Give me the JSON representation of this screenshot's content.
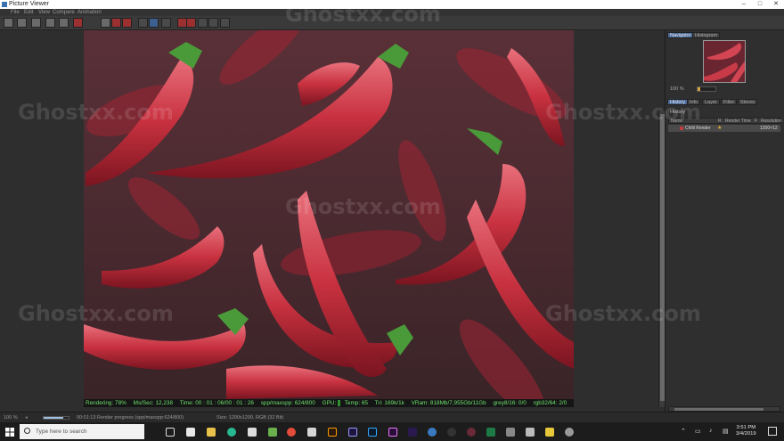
{
  "window": {
    "title": "Picture Viewer",
    "controls": [
      "–",
      "□",
      "✕"
    ]
  },
  "menu": [
    "File",
    "Edit",
    "View",
    "Compare",
    "Animation"
  ],
  "status": {
    "rendering": "Rendering: 78%",
    "mssec": "Ms/Sec: 12,238",
    "time": "Time: 00 : 01 : 06/00 : 01 : 26",
    "spp": "spp/maxspp: 624/800",
    "gpu": "GPU:",
    "temp": "Temp: 65",
    "tri": "Tri: 169k/1k",
    "vram": "VRam: 818Mb/7,955Gb/11Gb",
    "grey": "grey8/16: 0/0",
    "rgb": "rgb32/64: 2/0",
    "gpu_load": 0.5
  },
  "right_panel": {
    "tabs_top": [
      "Navigator",
      "Histogram"
    ],
    "zoom": "100 %",
    "tabs_mid": [
      "History",
      "Info",
      "Layer",
      "Filter",
      "Stereo"
    ],
    "history_title": "History",
    "columns": [
      "Name",
      "R",
      "Render Time",
      "F",
      "Resolution"
    ],
    "row": {
      "name": "Chilli Render",
      "res": "1200×12"
    }
  },
  "bottom": {
    "zoom": "100 %",
    "progress_text": "00:01:13 Render progress   (spp/maxspp:624/800)",
    "size": "Size: 1200x1200, RGB (32 Bit)",
    "render_progress": 0.78
  },
  "taskbar": {
    "search_placeholder": "Type here to search",
    "time": "3:51 PM",
    "date": "3/4/2019"
  },
  "watermark": "Ghostxx.com",
  "colors": {
    "status_green": "#6ee06e",
    "tab_active": "#4a6a9a",
    "history_dot": "#c43b3b"
  }
}
